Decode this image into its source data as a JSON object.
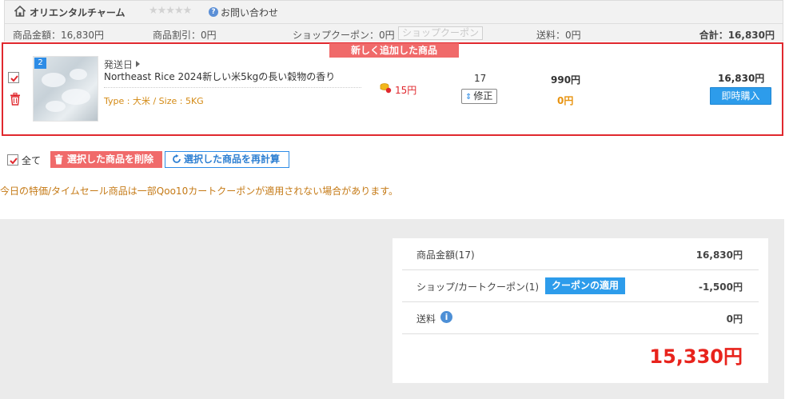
{
  "shop": {
    "name": "オリエンタルチャーム",
    "stars": "★★★★★",
    "contact": "お問い合わせ",
    "product_amount": "商品金額：16,830円",
    "product_discount": "商品割引：0円",
    "shop_coupon": "ショップクーポン：0円",
    "shop_coupon_button": "ショップクーポン",
    "shipping": "送料：0円",
    "total": "合計：16,830円"
  },
  "item": {
    "new_badge": "新しく追加した商品",
    "image_badge": "2",
    "ship_label": "発送日",
    "title": "Northeast Rice 2024新しい米5kgの長い穀物の香り",
    "option": "Type : 大米 / Size : 5KG",
    "points": "15円",
    "quantity": "17",
    "modify_label": "修正",
    "price": "990円",
    "discount": "0円",
    "total": "16,830円",
    "buy_now": "即時購入"
  },
  "actions": {
    "all_label": "全て",
    "delete_selected": "選択した商品を削除",
    "recalc_selected": "選択した商品を再計算"
  },
  "notice": "今日の特価/タイムセール商品は一部Qoo10カートクーポンが適用されない場合があります。",
  "summary": {
    "product_amount_label": "商品金額(17)",
    "product_amount_value": "16,830円",
    "coupon_label": "ショップ/カートクーポン(1)",
    "apply_coupon": "クーポンの適用",
    "coupon_value": "-1,500円",
    "shipping_label": "送料",
    "shipping_value": "0円",
    "grand_total": "15,330円"
  },
  "colors": {
    "accent_red": "#e0282e",
    "accent_blue": "#2d9ceb",
    "orange": "#e8930f",
    "total_red": "#e8231c"
  },
  "icons": [
    "home-icon",
    "help-icon",
    "checkbox-icon",
    "trash-icon",
    "point-icon",
    "info-icon",
    "refresh-icon"
  ]
}
